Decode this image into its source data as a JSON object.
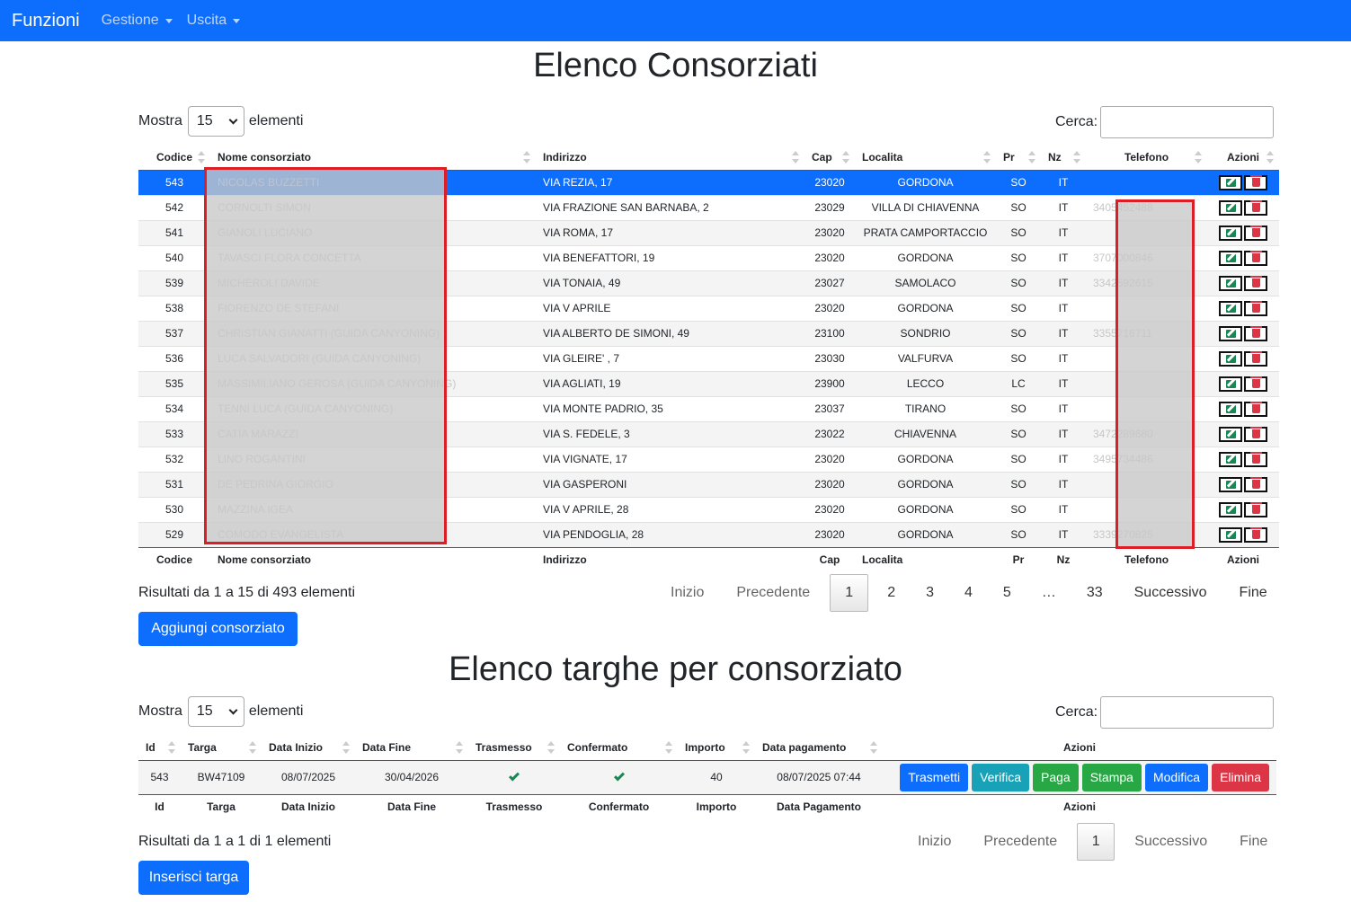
{
  "navbar": {
    "brand": "Funzioni",
    "menu1": "Gestione",
    "menu2": "Uscita"
  },
  "consorziati": {
    "title": "Elenco Consorziati",
    "show_label": "Mostra",
    "show_value": "15",
    "elements_label": "elementi",
    "search_label": "Cerca:",
    "columns": [
      "Codice",
      "Nome consorziato",
      "Indirizzo",
      "Cap",
      "Localita",
      "Pr",
      "Nz",
      "Telefono",
      "Azioni"
    ],
    "rows": [
      {
        "codice": "543",
        "nome": "NICOLAS BUZZETTI",
        "indirizzo": "VIA REZIA, 17",
        "cap": "23020",
        "localita": "GORDONA",
        "pr": "SO",
        "nz": "IT",
        "telefono": ""
      },
      {
        "codice": "542",
        "nome": "CORNOLTI SIMON",
        "indirizzo": "VIA FRAZIONE SAN BARNABA, 2",
        "cap": "23029",
        "localita": "VILLA DI CHIAVENNA",
        "pr": "SO",
        "nz": "IT",
        "telefono": "3405452488"
      },
      {
        "codice": "541",
        "nome": "GIANOLI LUCIANO",
        "indirizzo": "VIA ROMA, 17",
        "cap": "23020",
        "localita": "PRATA CAMPORTACCIO",
        "pr": "SO",
        "nz": "IT",
        "telefono": ""
      },
      {
        "codice": "540",
        "nome": "TAVASCI FLORA CONCETTA",
        "indirizzo": "VIA BENEFATTORI, 19",
        "cap": "23020",
        "localita": "GORDONA",
        "pr": "SO",
        "nz": "IT",
        "telefono": "3707000846"
      },
      {
        "codice": "539",
        "nome": "MICHEROLI DAVIDE",
        "indirizzo": "VIA TONAIA, 49",
        "cap": "23027",
        "localita": "SAMOLACO",
        "pr": "SO",
        "nz": "IT",
        "telefono": "3342592615"
      },
      {
        "codice": "538",
        "nome": "FIORENZO DE STEFANI",
        "indirizzo": "VIA V APRILE",
        "cap": "23020",
        "localita": "GORDONA",
        "pr": "SO",
        "nz": "IT",
        "telefono": ""
      },
      {
        "codice": "537",
        "nome": "CHRISTIAN GIANATTI (GUIDA CANYONING)",
        "indirizzo": "VIA ALBERTO DE SIMONI, 49",
        "cap": "23100",
        "localita": "SONDRIO",
        "pr": "SO",
        "nz": "IT",
        "telefono": "3355716711"
      },
      {
        "codice": "536",
        "nome": "LUCA SALVADORI (GUIDA CANYONING)",
        "indirizzo": "VIA GLEIRE' , 7",
        "cap": "23030",
        "localita": "VALFURVA",
        "pr": "SO",
        "nz": "IT",
        "telefono": ""
      },
      {
        "codice": "535",
        "nome": "MASSIMILIANO GEROSA (GUIDA CANYONING)",
        "indirizzo": "VIA AGLIATI, 19",
        "cap": "23900",
        "localita": "LECCO",
        "pr": "LC",
        "nz": "IT",
        "telefono": ""
      },
      {
        "codice": "534",
        "nome": "TENNI LUCA (GUIDA CANYONING)",
        "indirizzo": "VIA MONTE PADRIO, 35",
        "cap": "23037",
        "localita": "TIRANO",
        "pr": "SO",
        "nz": "IT",
        "telefono": ""
      },
      {
        "codice": "533",
        "nome": "CATIA MARAZZI",
        "indirizzo": "VIA S. FEDELE, 3",
        "cap": "23022",
        "localita": "CHIAVENNA",
        "pr": "SO",
        "nz": "IT",
        "telefono": "3472289680"
      },
      {
        "codice": "532",
        "nome": "LINO ROGANTINI",
        "indirizzo": "VIA VIGNATE, 17",
        "cap": "23020",
        "localita": "GORDONA",
        "pr": "SO",
        "nz": "IT",
        "telefono": "3495734486"
      },
      {
        "codice": "531",
        "nome": "DE PEDRINA GIORGIO",
        "indirizzo": "VIA GASPERONI",
        "cap": "23020",
        "localita": "GORDONA",
        "pr": "SO",
        "nz": "IT",
        "telefono": ""
      },
      {
        "codice": "530",
        "nome": "MAZZINA IGEA",
        "indirizzo": "VIA V APRILE, 28",
        "cap": "23020",
        "localita": "GORDONA",
        "pr": "SO",
        "nz": "IT",
        "telefono": ""
      },
      {
        "codice": "529",
        "nome": "COMODO EVANGELISTA",
        "indirizzo": "VIA PENDOGLIA, 28",
        "cap": "23020",
        "localita": "GORDONA",
        "pr": "SO",
        "nz": "IT",
        "telefono": "3339270825"
      }
    ],
    "info": "Risultati da 1 a 15 di 493 elementi",
    "pager": [
      "Inizio",
      "Precedente",
      "1",
      "2",
      "3",
      "4",
      "5",
      "…",
      "33",
      "Successivo",
      "Fine"
    ],
    "add_button": "Aggiungi consorziato"
  },
  "targhe": {
    "title": "Elenco targhe per consorziato",
    "show_label": "Mostra",
    "show_value": "15",
    "elements_label": "elementi",
    "search_label": "Cerca:",
    "columns": [
      "Id",
      "Targa",
      "Data Inizio",
      "Data Fine",
      "Trasmesso",
      "Confermato",
      "Importo",
      "Data pagamento",
      "Azioni"
    ],
    "footer_columns": [
      "Id",
      "Targa",
      "Data Inizio",
      "Data Fine",
      "Trasmesso",
      "Confermato",
      "Importo",
      "Data Pagamento",
      "Azioni"
    ],
    "row": {
      "id": "543",
      "targa": "BW47109",
      "data_inizio": "08/07/2025",
      "data_fine": "30/04/2026",
      "importo": "40",
      "data_pagamento": "08/07/2025 07:44"
    },
    "actions": [
      "Trasmetti",
      "Verifica",
      "Paga",
      "Stampa",
      "Modifica",
      "Elimina"
    ],
    "info": "Risultati da 1 a 1 di 1 elementi",
    "pager": [
      "Inizio",
      "Precedente",
      "1",
      "Successivo",
      "Fine"
    ],
    "add_button": "Inserisci targa"
  },
  "colors": {
    "primary": "#0d6efd",
    "info": "#17a2b8",
    "success": "#28a745",
    "danger": "#dc3545",
    "redaction_border": "#dc1f26"
  }
}
